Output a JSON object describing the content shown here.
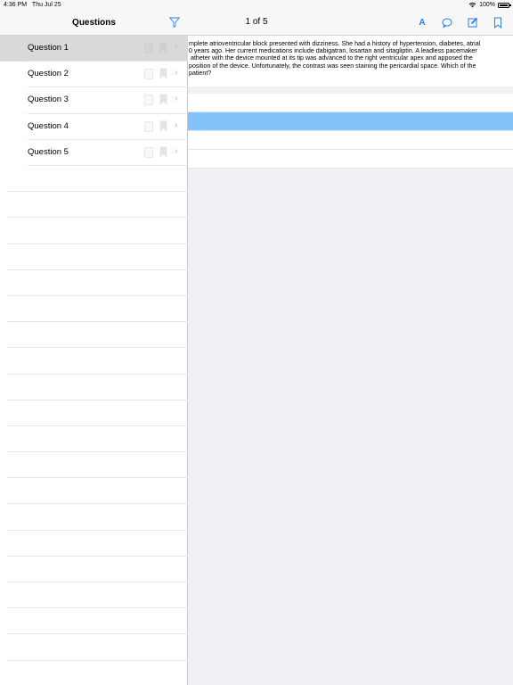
{
  "status": {
    "time": "4:36 PM",
    "date": "Thu Jul 25",
    "battery": "100%",
    "wifi_icon": "wifi-icon",
    "battery_icon": "battery-icon"
  },
  "sidebar": {
    "title": "Questions",
    "filter_icon": "filter-icon",
    "items": [
      {
        "label": "Question 1",
        "active": true
      },
      {
        "label": "Question 2",
        "active": false
      },
      {
        "label": "Question 3",
        "active": false
      },
      {
        "label": "Question 4",
        "active": false
      },
      {
        "label": "Question 5",
        "active": false
      }
    ]
  },
  "detail": {
    "counter": "1 of 5",
    "toolbar_icons": [
      "font-size-icon",
      "comment-icon",
      "edit-icon",
      "bookmark-icon"
    ],
    "font_label": "A",
    "question_lines": [
      "mplete atrioventricular block presented with dizziness. She had a history of hypertension, diabetes, atrial",
      "0 years ago. Her current medications include dabigatran, losartan and sitagliptin. A leadless pacemaker",
      "atheter with the device mounted at its tip was advanced to the right ventricular apex and apposed the",
      "position of the device. Unfortunately, the contrast was seen staining the pericardial space. Which of the",
      "patient?"
    ]
  },
  "colors": {
    "accent": "#2a7cf6",
    "selected_answer": "#85c2f9",
    "active_row": "#d9d9d9"
  }
}
